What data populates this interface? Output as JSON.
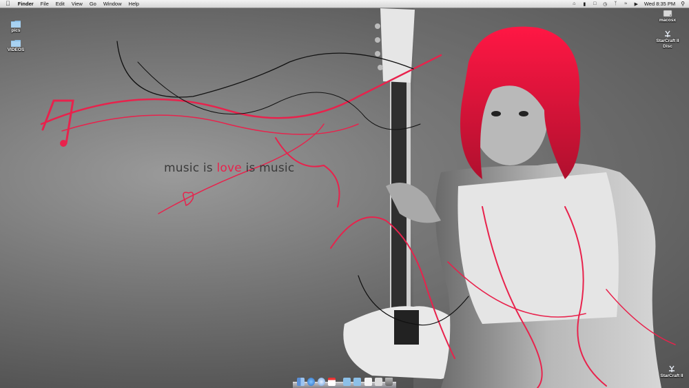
{
  "menubar": {
    "apple_icon": "apple-icon",
    "app_name": "Finder",
    "menus": [
      "File",
      "Edit",
      "View",
      "Go",
      "Window",
      "Help"
    ],
    "status_icons": [
      "script-icon",
      "battery-icon",
      "display-icon",
      "time-machine-icon",
      "bluetooth-icon",
      "wifi-icon",
      "volume-icon"
    ],
    "clock": "Wed 8:35 PM",
    "spotlight_icon": "spotlight-icon"
  },
  "desktop_icons_left": [
    {
      "label": "pics",
      "icon": "folder-icon"
    },
    {
      "label": "VIDEOS",
      "icon": "folder-icon"
    }
  ],
  "desktop_icons_right": [
    {
      "label": "macosx",
      "icon": "hard-drive-icon"
    },
    {
      "label": "StarCraft II Disc",
      "icon": "disc-app-icon"
    },
    {
      "label": "StarCraft II",
      "icon": "app-icon"
    }
  ],
  "wallpaper": {
    "tagline_before": "music is",
    "tagline_love": "love",
    "tagline_after": "is music",
    "accent_color": "#e8224c"
  },
  "dock": {
    "items": [
      "finder-icon",
      "safari-icon",
      "itunes-icon",
      "calendar-icon",
      "folder-icon",
      "folder-icon",
      "document-icon",
      "window-icon",
      "trash-icon"
    ]
  }
}
